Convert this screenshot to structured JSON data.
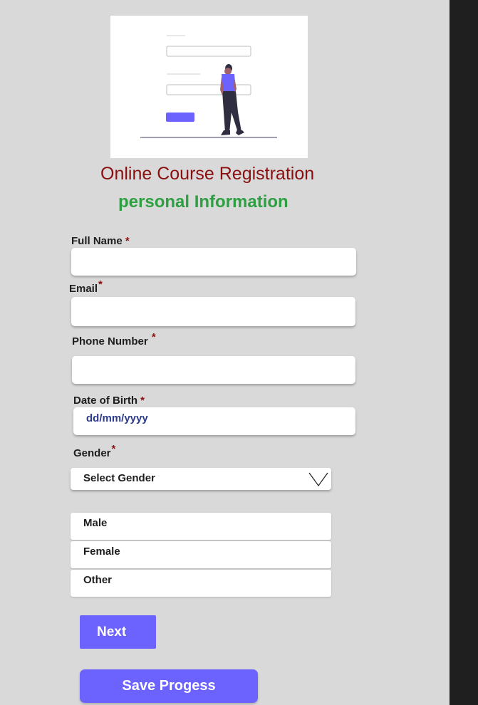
{
  "header": {
    "title": "Online Course Registration",
    "subtitle": "personal Information"
  },
  "form": {
    "required_marker": "*",
    "full_name": {
      "label": "Full Name",
      "value": ""
    },
    "email": {
      "label": "Email",
      "value": ""
    },
    "phone": {
      "label": "Phone Number",
      "value": ""
    },
    "dob": {
      "label": "Date of Birth",
      "placeholder": "dd/mm/yyyy"
    },
    "gender": {
      "label": "Gender",
      "selected": "Select Gender",
      "options": [
        "Male",
        "Female",
        "Other"
      ]
    }
  },
  "actions": {
    "next_label": "Next",
    "save_label": "Save Progess"
  },
  "colors": {
    "background": "#d9d9d9",
    "title": "#8a1010",
    "subtitle": "#2ea043",
    "accent": "#6c63ff",
    "required": "#8a1010",
    "placeholder": "#2c3a8c"
  },
  "icons": {
    "dropdown": "chevron-down-icon",
    "illustration": "registration-illustration"
  }
}
